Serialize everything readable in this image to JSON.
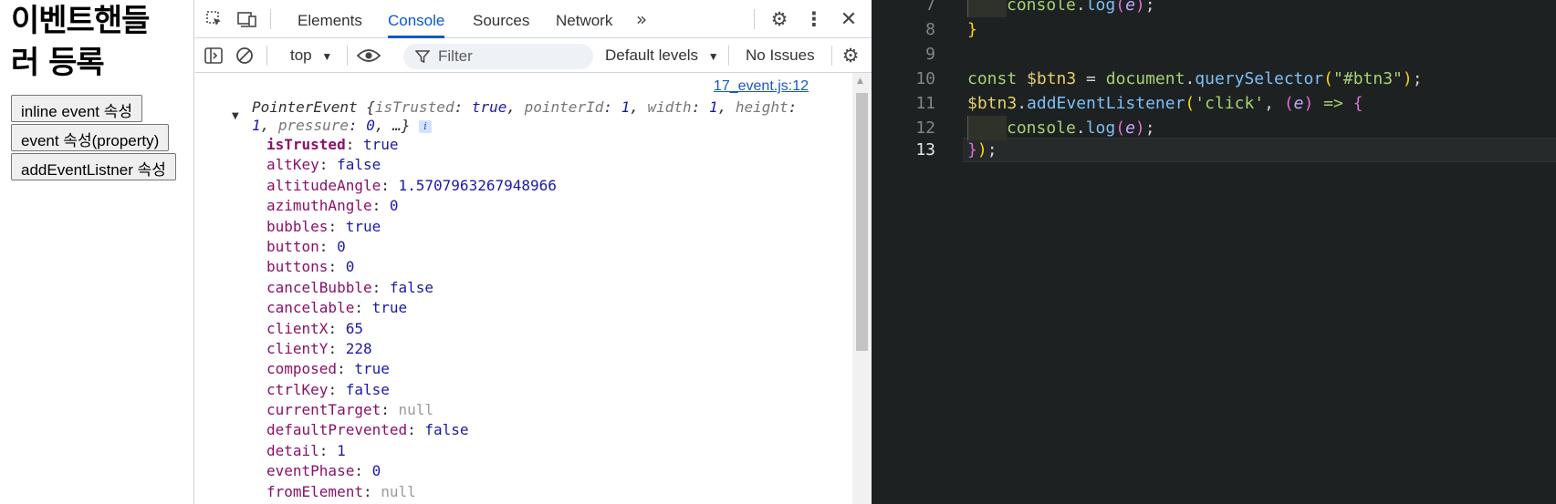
{
  "page": {
    "heading": "이벤트핸들러 등록",
    "buttons": [
      "inline event 속성",
      "event 속성(property)",
      "addEventListner 속성"
    ]
  },
  "devtools": {
    "tabs": [
      "Elements",
      "Console",
      "Sources",
      "Network"
    ],
    "active_tab": "Console",
    "context": "top",
    "filter_placeholder": "Filter",
    "levels": "Default levels",
    "issues": "No Issues",
    "source_link": "17_event.js:12",
    "event_head": {
      "type": "PointerEvent",
      "summary_parts": [
        {
          "k": "isTrusted",
          "v": "true"
        },
        {
          "k": "pointerId",
          "v": "1"
        },
        {
          "k": "width",
          "v": "1"
        },
        {
          "k": "height",
          "v": "1"
        },
        {
          "k": "pressure",
          "v": "0"
        }
      ]
    },
    "properties": [
      {
        "key": "isTrusted",
        "value": "true",
        "bold": true
      },
      {
        "key": "altKey",
        "value": "false"
      },
      {
        "key": "altitudeAngle",
        "value": "1.5707963267948966"
      },
      {
        "key": "azimuthAngle",
        "value": "0"
      },
      {
        "key": "bubbles",
        "value": "true"
      },
      {
        "key": "button",
        "value": "0"
      },
      {
        "key": "buttons",
        "value": "0"
      },
      {
        "key": "cancelBubble",
        "value": "false"
      },
      {
        "key": "cancelable",
        "value": "true"
      },
      {
        "key": "clientX",
        "value": "65"
      },
      {
        "key": "clientY",
        "value": "228"
      },
      {
        "key": "composed",
        "value": "true"
      },
      {
        "key": "ctrlKey",
        "value": "false"
      },
      {
        "key": "currentTarget",
        "value": "null"
      },
      {
        "key": "defaultPrevented",
        "value": "false"
      },
      {
        "key": "detail",
        "value": "1"
      },
      {
        "key": "eventPhase",
        "value": "0"
      },
      {
        "key": "fromElement",
        "value": "null"
      }
    ]
  },
  "editor": {
    "line_numbers": [
      "7",
      "8",
      "9",
      "10",
      "11",
      "12",
      "13"
    ],
    "current_line": "13",
    "lines": [
      "console.log(e);",
      "}",
      "",
      "const $btn3 = document.querySelector(\"#btn3\");",
      "$btn3.addEventListener('click', (e) => {",
      "console.log(e);",
      "});"
    ]
  }
}
